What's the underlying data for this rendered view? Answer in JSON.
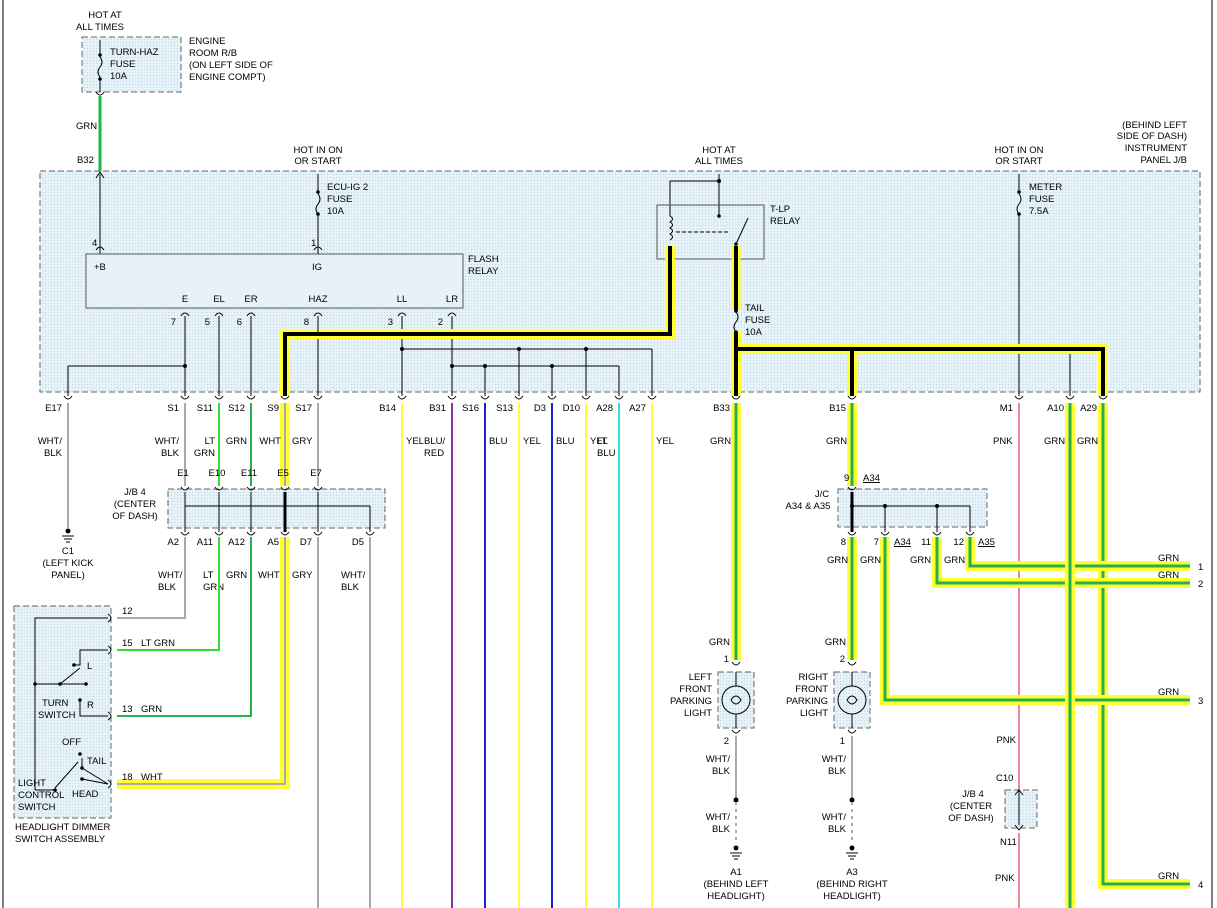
{
  "top": {
    "hot_at_all_times": [
      "HOT AT",
      "ALL TIMES"
    ],
    "fuse_turn_haz": [
      "TURN-HAZ",
      "FUSE",
      "10A"
    ],
    "engine_room_rb": [
      "ENGINE",
      "ROOM R/B",
      "(ON LEFT SIDE OF",
      "ENGINE COMPT)"
    ],
    "wire_grn": "GRN",
    "b32": "B32"
  },
  "ipjb": {
    "label": [
      "(BEHIND LEFT",
      "SIDE OF DASH)",
      "INSTRUMENT",
      "PANEL J/B"
    ],
    "hot_in_on_1": [
      "HOT IN ON",
      "OR START"
    ],
    "ecu_ig2": [
      "ECU-IG 2",
      "FUSE",
      "10A"
    ],
    "hot_at_all_times_2": [
      "HOT AT",
      "ALL TIMES"
    ],
    "tlp_relay": [
      "T-LP",
      "RELAY"
    ],
    "tail_fuse": [
      "TAIL",
      "FUSE",
      "10A"
    ],
    "hot_in_on_2": [
      "HOT IN ON",
      "OR START"
    ],
    "meter_fuse": [
      "METER",
      "FUSE",
      "7.5A"
    ]
  },
  "flash_relay": {
    "label": [
      "FLASH",
      "RELAY"
    ],
    "pin_b": "+B",
    "pin_ig": "IG",
    "pin4": "4",
    "pin1": "1",
    "pins": [
      {
        "n": "7",
        "name": "E"
      },
      {
        "n": "5",
        "name": "EL"
      },
      {
        "n": "6",
        "name": "ER"
      },
      {
        "n": "8",
        "name": "HAZ"
      },
      {
        "n": "3",
        "name": "LL"
      },
      {
        "n": "2",
        "name": "LR"
      }
    ]
  },
  "connectors": {
    "row1": [
      {
        "id": "E17",
        "wire": [
          "WHT/",
          "BLK"
        ]
      },
      {
        "id": "S1",
        "wire": [
          "WHT/",
          "BLK"
        ]
      },
      {
        "id": "S11",
        "wire": [
          "LT",
          "GRN"
        ]
      },
      {
        "id": "S12",
        "wire": [
          "GRN"
        ]
      },
      {
        "id": "S9",
        "wire": [
          "WHT"
        ]
      },
      {
        "id": "S17",
        "wire": [
          "GRY"
        ]
      },
      {
        "id": "B14",
        "wire": [
          "YEL"
        ]
      },
      {
        "id": "B31",
        "wire": [
          "BLU/",
          "RED"
        ]
      },
      {
        "id": "S16",
        "wire": [
          "BLU"
        ]
      },
      {
        "id": "S13",
        "wire": [
          "YEL"
        ]
      },
      {
        "id": "D3",
        "wire": [
          "BLU"
        ]
      },
      {
        "id": "D10",
        "wire": [
          "YEL"
        ]
      },
      {
        "id": "A28",
        "wire": [
          "LT",
          "BLU"
        ]
      },
      {
        "id": "A27",
        "wire": [
          "YEL"
        ]
      },
      {
        "id": "B33",
        "wire": [
          "GRN"
        ]
      },
      {
        "id": "B15",
        "wire": [
          "GRN"
        ]
      },
      {
        "id": "M1",
        "wire": [
          "PNK"
        ]
      },
      {
        "id": "A10",
        "wire": [
          "GRN"
        ]
      },
      {
        "id": "A29",
        "wire": [
          "GRN"
        ]
      }
    ]
  },
  "jb4": {
    "label": [
      "J/B 4",
      "(CENTER",
      "OF DASH)"
    ],
    "top": [
      "E1",
      "E10",
      "E11",
      "E5",
      "E7"
    ],
    "bottom": [
      "A2",
      "A11",
      "A12",
      "A5",
      "D7",
      "D5"
    ],
    "wires_below": [
      [
        "WHT/",
        "BLK"
      ],
      [
        "LT",
        "GRN"
      ],
      [
        "GRN"
      ],
      [
        "WHT"
      ],
      [
        "GRY"
      ],
      [
        "WHT/",
        "BLK"
      ]
    ]
  },
  "ground_c1": {
    "id": "C1",
    "desc": [
      "(LEFT KICK",
      "PANEL)"
    ]
  },
  "switch": {
    "pins": [
      "12",
      "15",
      "13",
      "18"
    ],
    "wires": [
      "LT GRN",
      "GRN",
      "WHT"
    ],
    "turn": [
      "TURN",
      "SWITCH"
    ],
    "l": "L",
    "r": "R",
    "off": "OFF",
    "tail": "TAIL",
    "head": "HEAD",
    "light": [
      "LIGHT",
      "CONTROL",
      "SWITCH"
    ],
    "assembly": [
      "HEADLIGHT DIMMER",
      "SWITCH ASSEMBLY"
    ]
  },
  "jc": {
    "label": [
      "J/C",
      "A34 & A35"
    ],
    "pin9": "9",
    "a34_top": "A34",
    "pins_bottom": [
      "8",
      "7",
      "11",
      "12"
    ],
    "a34_bottom": "A34",
    "a35_bottom": "A35",
    "wires_bottom": [
      "GRN",
      "GRN",
      "GRN",
      "GRN"
    ]
  },
  "left_parking": {
    "pin_top": "1",
    "pin_bottom": "2",
    "label": [
      "LEFT",
      "FRONT",
      "PARKING",
      "LIGHT"
    ],
    "wire_top": "GRN",
    "wire_bottom": [
      "WHT/",
      "BLK"
    ],
    "wire_bottom2": [
      "WHT/",
      "BLK"
    ],
    "ground": "A1",
    "ground_desc": [
      "(BEHIND LEFT",
      "HEADLIGHT)"
    ]
  },
  "right_parking": {
    "pin_top": "2",
    "pin_bottom": "1",
    "label": [
      "RIGHT",
      "FRONT",
      "PARKING",
      "LIGHT"
    ],
    "wire_top": "GRN",
    "wire_bottom": [
      "WHT/",
      "BLK"
    ],
    "wire_bottom2": [
      "WHT/",
      "BLK"
    ],
    "ground": "A3",
    "ground_desc": [
      "(BEHIND RIGHT",
      "HEADLIGHT)"
    ]
  },
  "jb4_c10": {
    "label": [
      "J/B 4",
      "(CENTER",
      "OF DASH)"
    ],
    "top": "C10",
    "bottom": "N11",
    "wire_above": "PNK",
    "wire_below": "PNK"
  },
  "right_outputs": [
    {
      "n": "1",
      "wire": "GRN"
    },
    {
      "n": "2",
      "wire": "GRN"
    },
    {
      "n": "3",
      "wire": "GRN"
    },
    {
      "n": "4",
      "wire": "GRN"
    }
  ],
  "colors": {
    "highlight": "#ffff33",
    "grn": "#22b14c",
    "ltgrn": "#33dd33",
    "yel": "#ffff33",
    "blu": "#2020d0",
    "bluRed": "#8833aa",
    "ltblu": "#33dddd",
    "pnk": "#ee8899",
    "gry": "#aaaaaa",
    "box_fill": "#e0f0f8"
  }
}
